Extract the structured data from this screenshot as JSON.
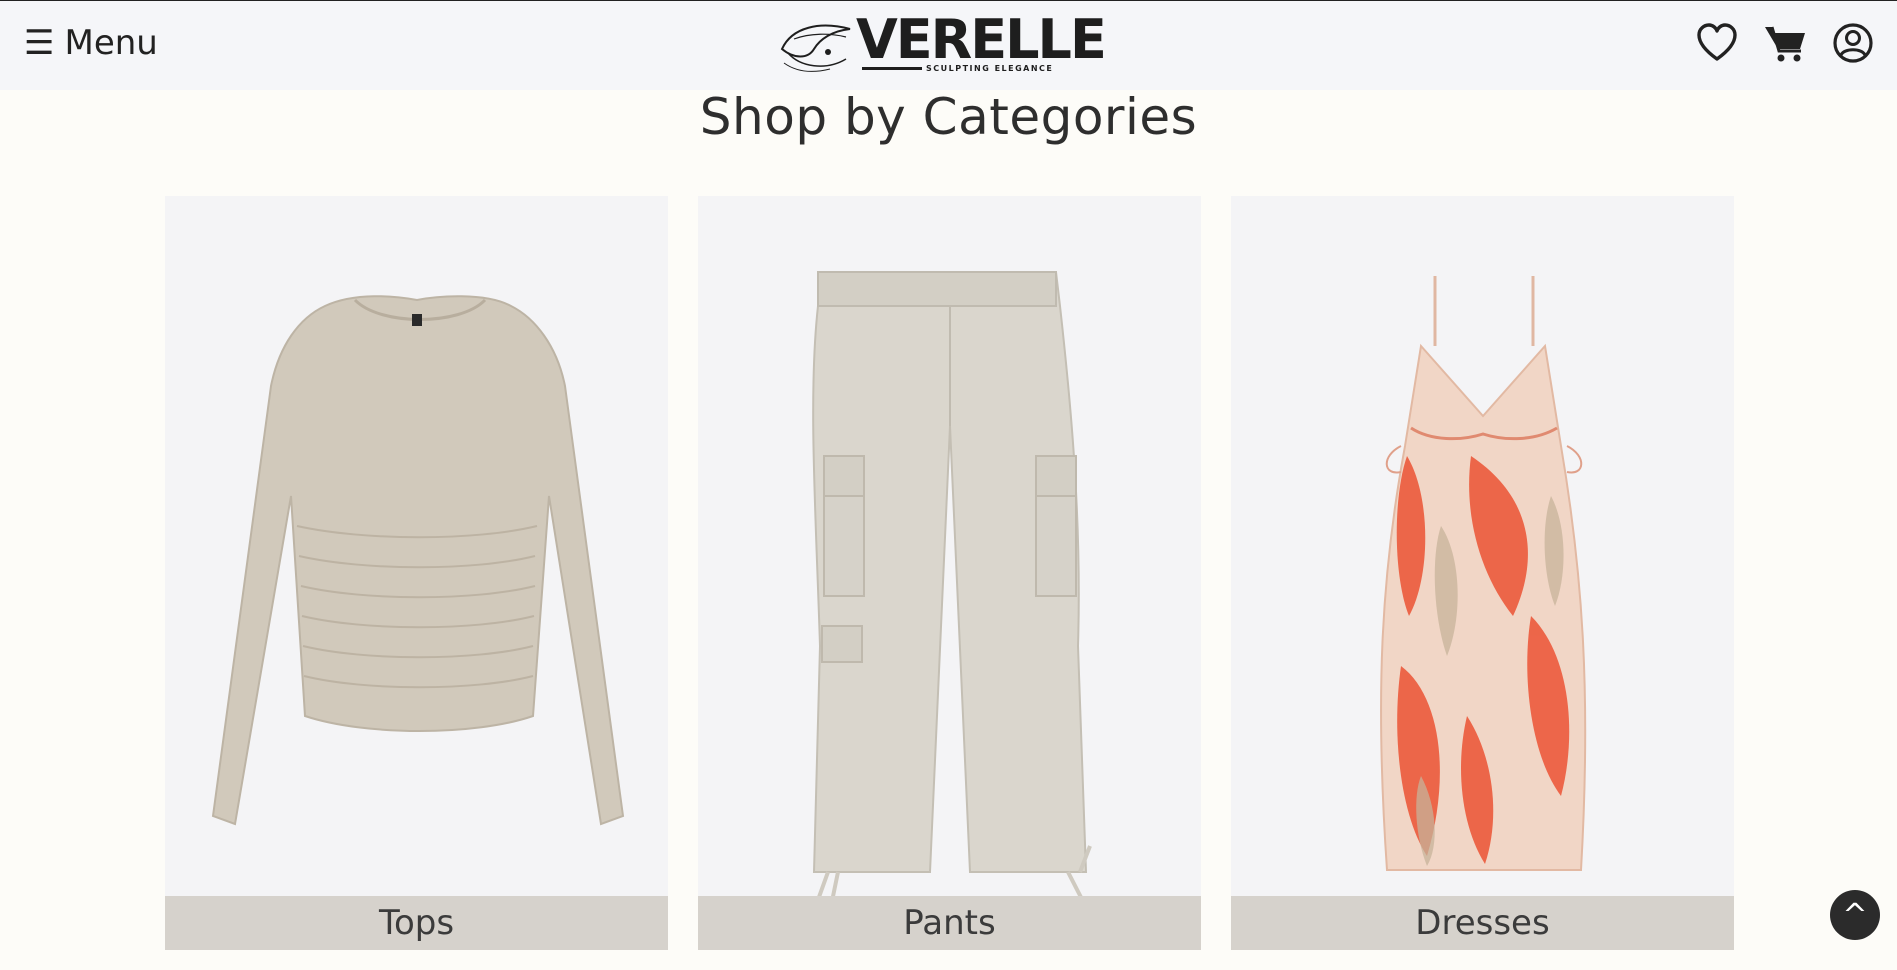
{
  "header": {
    "menu_label": "Menu",
    "brand_name": "VERELLE",
    "brand_tagline": "SCULPTING ELEGANCE",
    "icons": [
      "heart-icon",
      "cart-icon",
      "account-icon"
    ]
  },
  "section": {
    "title": "Shop by Categories"
  },
  "categories": [
    {
      "label": "Tops",
      "color": "#d9d3c7"
    },
    {
      "label": "Pants",
      "color": "#dcd9d1"
    },
    {
      "label": "Dresses",
      "color": "#ec6a4c"
    }
  ],
  "scroll_top": {
    "glyph": "^"
  },
  "colors": {
    "background": "#fdfcf8",
    "header_bg": "#f5f6f9",
    "label_bar": "#d6d2cc",
    "dark": "#222222"
  }
}
